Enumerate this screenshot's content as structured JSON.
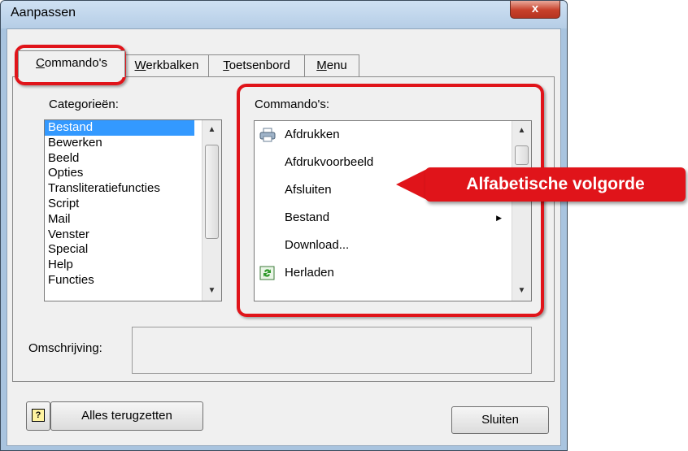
{
  "window": {
    "title": "Aanpassen",
    "close_glyph": "x"
  },
  "tabs": [
    {
      "label_pre": "",
      "label_u": "C",
      "label_post": "ommando's"
    },
    {
      "label_pre": "",
      "label_u": "W",
      "label_post": "erkbalken"
    },
    {
      "label_pre": "",
      "label_u": "T",
      "label_post": "oetsenbord"
    },
    {
      "label_pre": "",
      "label_u": "M",
      "label_post": "enu"
    }
  ],
  "categories": {
    "label": "Categorieën:",
    "items": [
      "Bestand",
      "Bewerken",
      "Beeld",
      "Opties",
      "Transliteratiefuncties",
      "Script",
      "Mail",
      "Venster",
      "Special",
      "Help",
      "Functies"
    ],
    "selected_index": 0
  },
  "commands": {
    "label": "Commando's:",
    "items": [
      {
        "label": "Afdrukken",
        "icon": "printer-icon"
      },
      {
        "label": "Afdrukvoorbeeld",
        "icon": ""
      },
      {
        "label": "Afsluiten",
        "icon": ""
      },
      {
        "label": "Bestand",
        "icon": "",
        "submenu": true
      },
      {
        "label": "Download...",
        "icon": ""
      },
      {
        "label": "Herladen",
        "icon": "reload-icon"
      }
    ]
  },
  "description": {
    "label": "Omschrijving:",
    "value": ""
  },
  "buttons": {
    "help": "?",
    "reset": "Alles terugzetten",
    "close": "Sluiten"
  },
  "callout": {
    "text": "Alfabetische volgorde"
  },
  "colors": {
    "highlight": "#e0141a",
    "selection": "#3399ff"
  }
}
